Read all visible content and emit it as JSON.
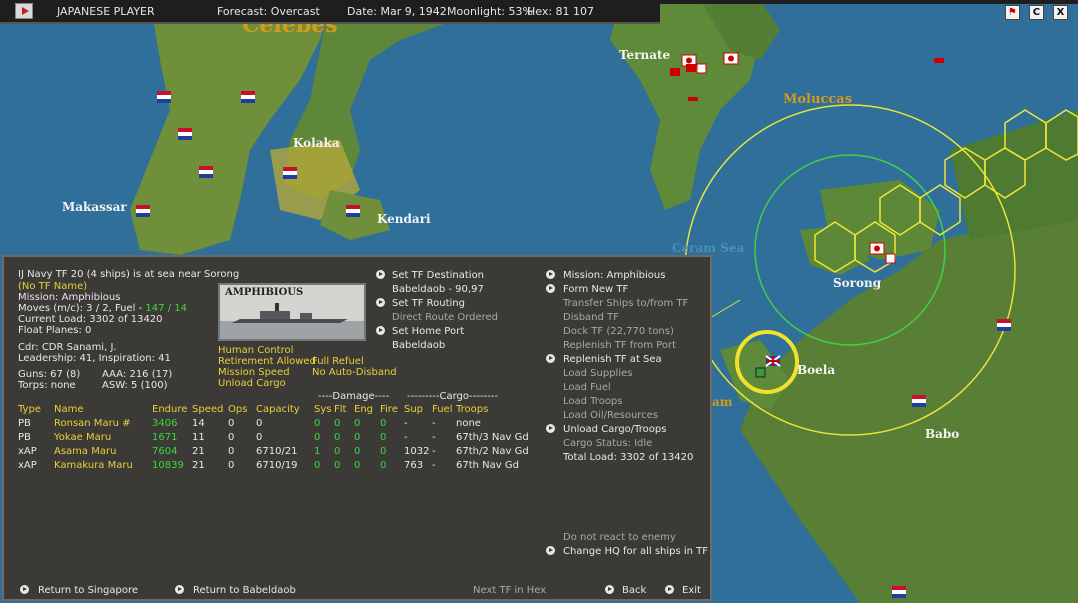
{
  "topbar": {
    "player": "JAPANESE PLAYER",
    "forecast": "Forecast: Overcast",
    "date": "Date: Mar 9, 1942",
    "moonlight": "Moonlight: 53%",
    "hex": "Hex: 81 107"
  },
  "top_right_buttons": [
    "flag",
    "C",
    "X"
  ],
  "map_labels": {
    "celebes": "Celebes",
    "ternate": "Ternate",
    "moluccas": "Moluccas",
    "kolaka": "Kolaka",
    "makassar": "Makassar",
    "kendari": "Kendari",
    "ceram_sea": "Ceram Sea",
    "sorong": "Sorong",
    "boela": "Boela",
    "babo": "Babo",
    "am": "am"
  },
  "panel": {
    "tf_line1": "IJ Navy TF 20 (4 ships) is at sea near Sorong",
    "tf_name": "(No TF Name)",
    "mission": "Mission: Amphibious",
    "moves_prefix": "Moves (m/c): 3 / 2, Fuel - ",
    "fuel": "147 / 14",
    "current_load": "Current Load: 3302 of 13420",
    "float_planes": "Float Planes: 0",
    "cdr": "Cdr: CDR Sanami, J.",
    "leadership": "Leadership: 41, Inspiration: 41",
    "guns": "Guns: 67 (8)",
    "aaa": "AAA: 216 (17)",
    "torps": "Torps: none",
    "asw": "ASW: 5 (100)",
    "ship_class_image_label": "AMPHIBIOUS",
    "options": {
      "human_control": "Human Control",
      "retirement": "Retirement Allowed",
      "full_refuel": "Full Refuel",
      "mission_speed": "Mission Speed",
      "no_auto_disband": "No Auto-Disband",
      "unload_cargo": "Unload Cargo"
    },
    "middle_menu": {
      "set_destination": "Set TF Destination",
      "destination_value": "Babeldaob - 90,97",
      "set_routing": "Set TF Routing",
      "direct_route": "Direct Route Ordered",
      "set_home_port": "Set Home Port",
      "home_port_value": "Babeldaob"
    },
    "right_menu": {
      "mission": "Mission: Amphibious",
      "form_new": "Form New TF",
      "transfer": "Transfer Ships to/from TF",
      "disband": "Disband TF",
      "dock": "Dock TF (22,770 tons)",
      "replenish_port": "Replenish TF from Port",
      "replenish_sea": "Replenish TF at Sea",
      "load_supplies": "Load Supplies",
      "load_fuel": "Load Fuel",
      "load_troops": "Load Troops",
      "load_oil": "Load Oil/Resources",
      "unload_cargo": "Unload Cargo/Troops",
      "cargo_status": "Cargo Status: Idle",
      "total_load": "Total Load: 3302 of 13420",
      "no_react": "Do not react to enemy",
      "change_hq": "Change HQ for all ships in TF"
    },
    "table": {
      "group_damage": "----Damage----",
      "group_cargo": "---------Cargo--------",
      "headers": [
        "Type",
        "Name",
        "Endure",
        "Speed",
        "Ops",
        "Capacity",
        "Sys",
        "Flt",
        "Eng",
        "Fire",
        "Sup",
        "Fuel",
        "Troops"
      ],
      "rows": [
        [
          "PB",
          "Ronsan Maru #",
          "3406",
          "14",
          "0",
          "0",
          "0",
          "0",
          "0",
          "0",
          "-",
          "-",
          "none"
        ],
        [
          "PB",
          "Yokae Maru",
          "1671",
          "11",
          "0",
          "0",
          "0",
          "0",
          "0",
          "0",
          "-",
          "-",
          "67th/3 Nav Gd"
        ],
        [
          "xAP",
          "Asama Maru",
          "7604",
          "21",
          "0",
          "6710/21",
          "1",
          "0",
          "0",
          "0",
          "1032",
          "-",
          "67th/2 Nav Gd"
        ],
        [
          "xAP",
          "Kamakura Maru",
          "10839",
          "21",
          "0",
          "6710/19",
          "0",
          "0",
          "0",
          "0",
          "763",
          "-",
          "67th Nav Gd"
        ]
      ]
    },
    "bottom": {
      "return_singapore": "Return to Singapore",
      "return_babeldaob": "Return to Babeldaob",
      "next_tf": "Next TF in Hex",
      "back": "Back",
      "exit": "Exit"
    }
  }
}
